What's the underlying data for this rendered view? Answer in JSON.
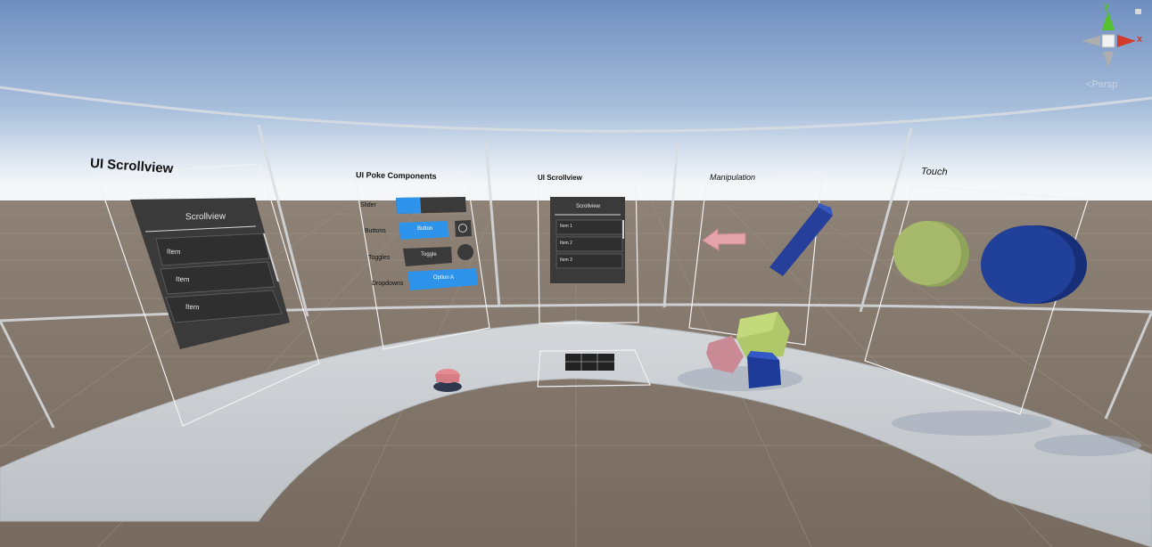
{
  "panels": {
    "scrollview_large": {
      "title": "UI Scrollview",
      "header": "Scrollview",
      "items": [
        "Item",
        "Item",
        "Item"
      ]
    },
    "poke_components": {
      "title": "UI Poke Components",
      "rows": [
        "Slider",
        "Buttons",
        "Toggles",
        "Dropdowns"
      ],
      "button_label": "Button",
      "toggle_label": "Toggle",
      "dropdown_label": "Option A",
      "slider_value": 0.35
    },
    "scrollview_small": {
      "title": "UI Scrollview",
      "header": "Scrollview",
      "items": [
        "Item 1",
        "Item 2",
        "Item 3"
      ]
    },
    "manipulation": {
      "title": "Manipulation"
    },
    "touch": {
      "title": "Touch"
    }
  },
  "gizmo": {
    "y_label": "y",
    "x_label": "x",
    "projection": "Persp"
  },
  "colors": {
    "accent_blue": "#2e93ea",
    "panel_dark": "#3a3a3a",
    "floor": "#7a6e63",
    "sky_top": "#6f8fbf",
    "ring": "#c8ccd0",
    "green_y": "#55c12f",
    "red_x": "#d23a2a",
    "sphere_green": "#a5b868",
    "sphere_blue": "#21409a"
  }
}
